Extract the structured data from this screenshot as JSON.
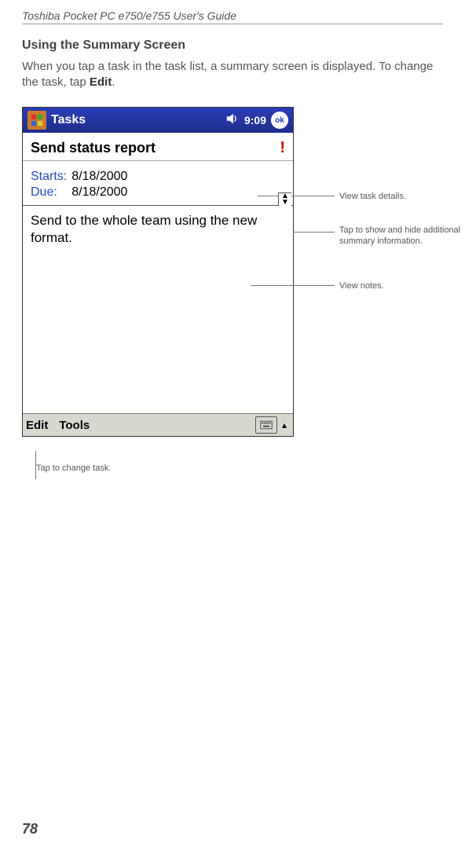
{
  "header": "Toshiba Pocket PC e750/e755  User's Guide",
  "section_title": "Using the Summary Screen",
  "body_text_1": "When you tap a task in the task list, a summary screen is displayed. To change the task, tap  ",
  "body_text_bold": "Edit",
  "body_text_2": ".",
  "device": {
    "titlebar": {
      "app": "Tasks",
      "time": "9:09",
      "ok": "ok"
    },
    "task_title": "Send status report",
    "priority_mark": "!",
    "details": {
      "starts_label": "Starts:",
      "starts_value": "8/18/2000",
      "due_label": "Due:",
      "due_value": "8/18/2000"
    },
    "notes": "Send to the whole team using the new format.",
    "bottombar": {
      "edit": "Edit",
      "tools": "Tools"
    }
  },
  "callouts": {
    "view_details": "View task details.",
    "toggle": "Tap to show and hide additional summary information.",
    "view_notes": "View notes.",
    "change_task": "Tap to change task."
  },
  "page_number": "78"
}
